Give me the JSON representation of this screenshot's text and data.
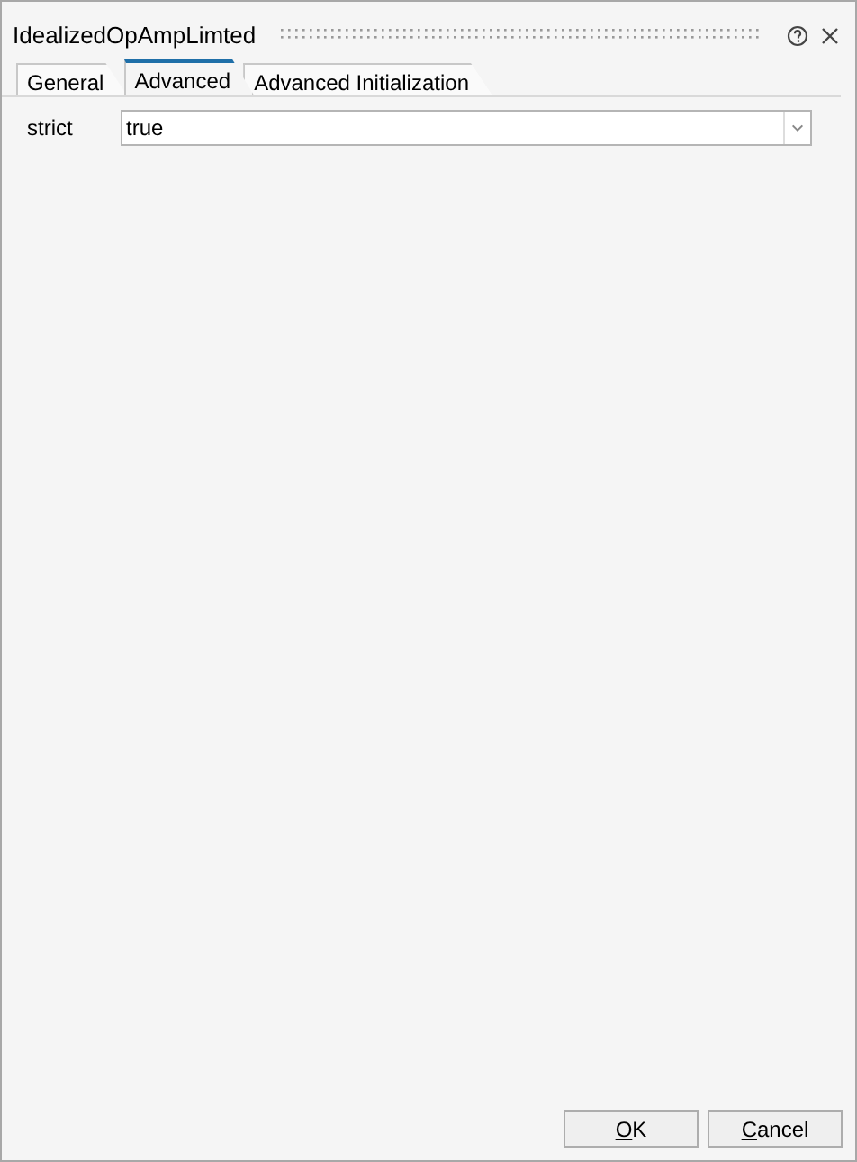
{
  "window": {
    "title": "IdealizedOpAmpLimted"
  },
  "tabs": [
    {
      "label": "General",
      "selected": false
    },
    {
      "label": "Advanced",
      "selected": true
    },
    {
      "label": "Advanced Initialization",
      "selected": false
    }
  ],
  "properties": [
    {
      "label": "strict",
      "value": "true"
    }
  ],
  "buttons": [
    "OK",
    "Cancel"
  ]
}
